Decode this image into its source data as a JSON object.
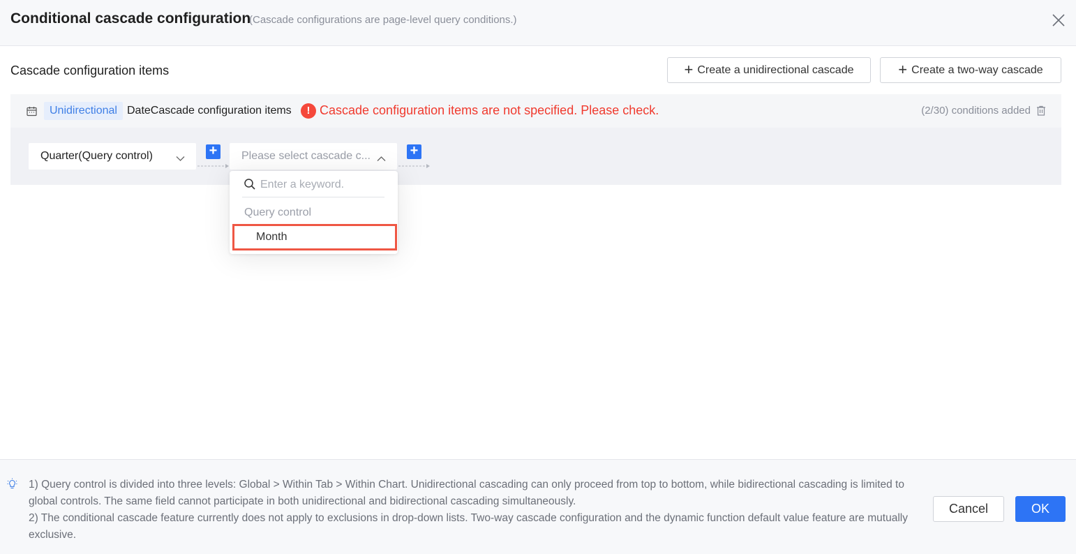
{
  "header": {
    "title": "Conditional cascade configuration",
    "subtitle": "(Cascade configurations are page-level query conditions.)"
  },
  "section": {
    "title": "Cascade configuration items",
    "create_unidirectional_label": "Create a unidirectional cascade",
    "create_two_way_label": "Create a two-way cascade"
  },
  "item": {
    "tag": "Unidirectional",
    "name": "DateCascade configuration items",
    "error_message": "Cascade configuration items are not specified. Please check.",
    "count_text": "(2/30) conditions added",
    "first_select_value": "Quarter(Query control)",
    "second_select_placeholder": "Please select cascade c..."
  },
  "dropdown": {
    "search_placeholder": "Enter a keyword.",
    "group_label": "Query control",
    "options": [
      "Month"
    ]
  },
  "footer": {
    "note_1": "1) Query control is divided into three levels: Global > Within Tab > Within Chart. Unidirectional cascading can only proceed from top to bottom, while bidirectional cascading is limited to global controls. The same field cannot participate in both unidirectional and bidirectional cascading simultaneously.",
    "note_2": "2) The conditional cascade feature currently does not apply to exclusions in drop-down lists. Two-way cascade configuration and the dynamic function default value feature are mutually exclusive.",
    "cancel_label": "Cancel",
    "ok_label": "OK"
  },
  "colors": {
    "primary": "#2d74f5",
    "error": "#f03a2e",
    "highlight_border": "#ef5744",
    "tag_bg": "#e6eefc"
  }
}
